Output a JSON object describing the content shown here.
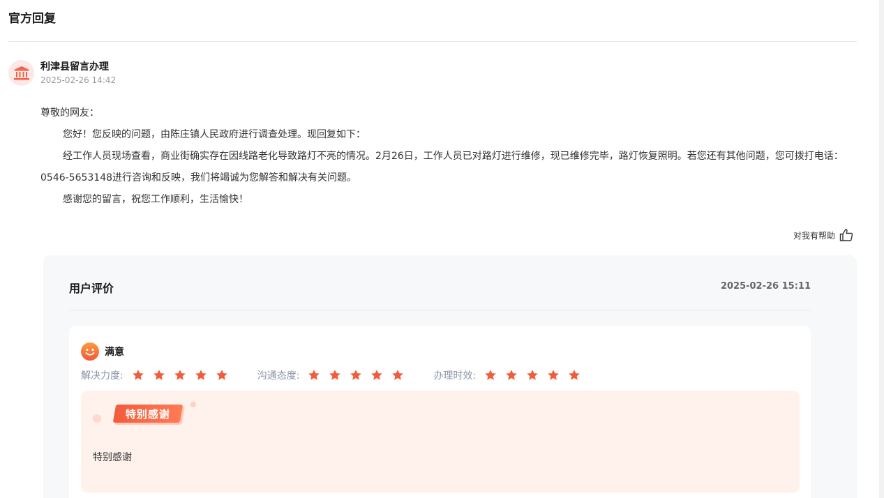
{
  "section": {
    "title": "官方回复"
  },
  "reply": {
    "avatar_icon": "government-building-icon",
    "replier": "利津县留言办理",
    "time": "2025-02-26 14:42",
    "greeting": "尊敬的网友：",
    "paragraphs": [
      "您好！您反映的问题，由陈庄镇人民政府进行调查处理。现回复如下：",
      "经工作人员现场查看，商业街确实存在因线路老化导致路灯不亮的情况。2月26日，工作人员已对路灯进行维修，现已维修完毕，路灯恢复照明。若您还有其他问题，您可拨打电话：0546-5653148进行咨询和反映，我们将竭诚为您解答和解决有关问题。",
      "感谢您的留言，祝您工作顺利，生活愉快！"
    ]
  },
  "helpful": {
    "label": "对我有帮助",
    "icon": "thumbs-up-icon"
  },
  "evaluation": {
    "title": "用户评价",
    "time": "2025-02-26 15:11",
    "satisfaction": {
      "label": "满意",
      "icon": "smiley-face-icon"
    },
    "ratings": [
      {
        "label": "解决力度:",
        "stars": 5,
        "max": 5
      },
      {
        "label": "沟通态度:",
        "stars": 5,
        "max": 5
      },
      {
        "label": "办理时效:",
        "stars": 5,
        "max": 5
      }
    ],
    "badge": "特别感谢",
    "comment": "特别感谢"
  },
  "colors": {
    "accent": "#f25c3b",
    "star": "#f25c3b",
    "panel_bg": "#f7f8fa",
    "thanks_bg": "#fff1ec",
    "rating_label": "#8a94a6"
  }
}
